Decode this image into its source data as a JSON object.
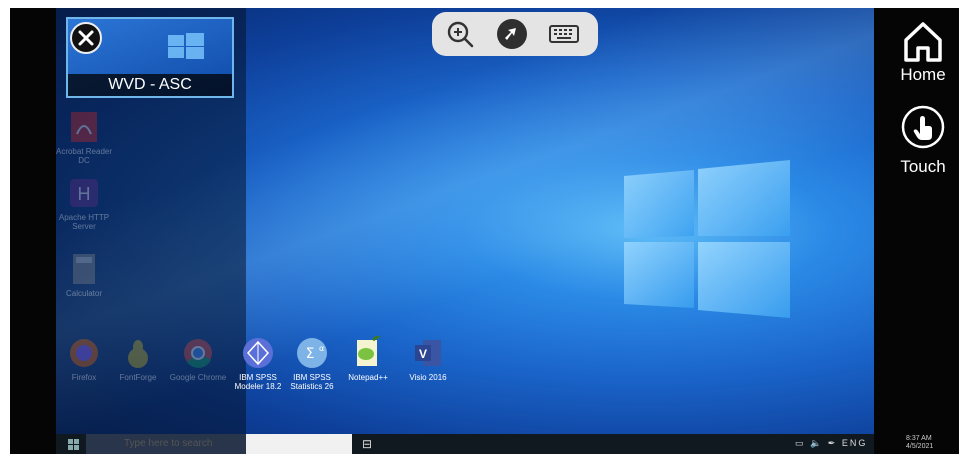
{
  "session": {
    "name": "WVD - ASC"
  },
  "toolbar": {
    "zoom": "zoom-icon",
    "connection": "remote-connection-icon",
    "keyboard": "keyboard-icon"
  },
  "side": {
    "home_label": "Home",
    "touch_label": "Touch"
  },
  "desktop_icons": [
    {
      "label": "Acrobat Reader DC",
      "icon": "pdf-icon",
      "dimmed": true
    },
    {
      "label": "Apache HTTP Server",
      "icon": "app-icon",
      "dimmed": true
    },
    {
      "label": "Calculator",
      "icon": "calculator-icon",
      "dimmed": true
    },
    {
      "label": "Firefox",
      "icon": "firefox-icon",
      "dimmed": true
    },
    {
      "label": "FontForge",
      "icon": "pear-icon",
      "dimmed": true
    },
    {
      "label": "Google Chrome",
      "icon": "chrome-icon",
      "dimmed": true
    },
    {
      "label": "IBM SPSS Modeler 18.2",
      "icon": "spss-modeler-icon",
      "dimmed": false
    },
    {
      "label": "IBM SPSS Statistics 26",
      "icon": "spss-statistics-icon",
      "dimmed": false
    },
    {
      "label": "Notepad++",
      "icon": "notepad-icon",
      "dimmed": false
    },
    {
      "label": "Visio 2016",
      "icon": "visio-icon",
      "dimmed": false
    }
  ],
  "taskbar": {
    "search_placeholder": "Type here to search",
    "tray_text": "ENG",
    "time": "8:37 AM",
    "date": "4/5/2021"
  },
  "colors": {
    "accent": "#6fb6ea",
    "desktop": "#1a63c8",
    "toolbar_bg": "#e4e4e4"
  }
}
